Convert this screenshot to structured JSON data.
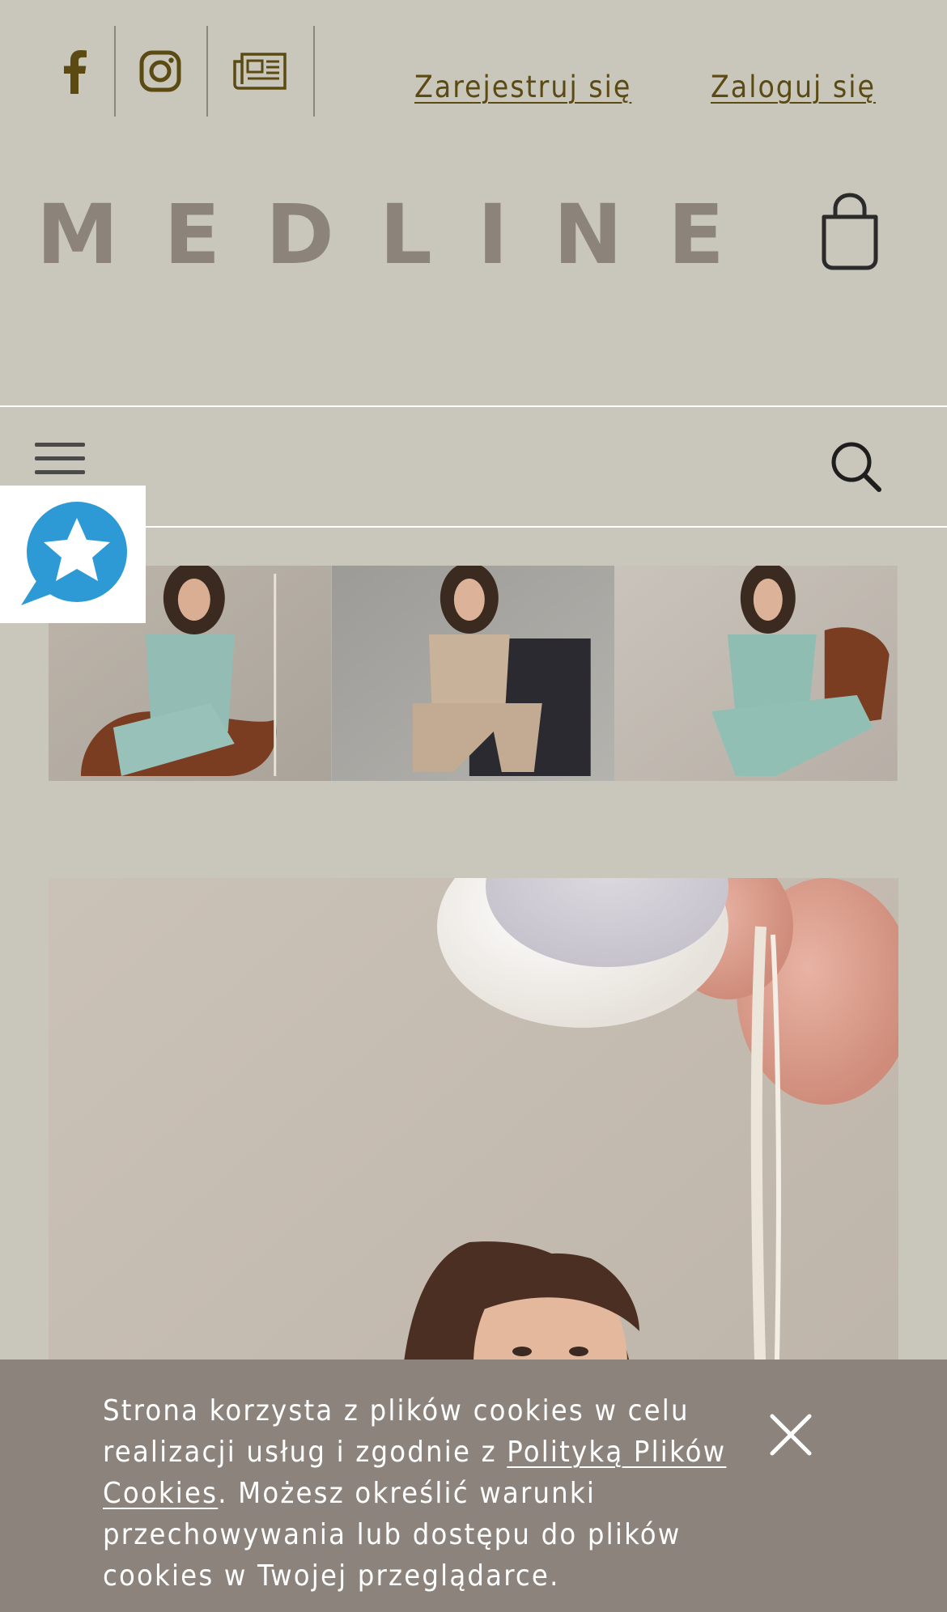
{
  "header": {
    "social": [
      {
        "icon": "facebook-icon"
      },
      {
        "icon": "instagram-icon"
      },
      {
        "icon": "newspaper-icon"
      }
    ],
    "register_label": "Zarejestruj się",
    "login_label": "Zaloguj się",
    "logo_text": "MEDLINE",
    "cart_icon": "shopping-bag-icon"
  },
  "nav": {
    "menu_icon": "hamburger-menu-icon",
    "search_icon": "search-icon"
  },
  "review_badge": {
    "icon": "star-chat-icon",
    "color": "#2d9ad6"
  },
  "colors": {
    "background": "#c9c6bb",
    "link": "#5b4a12",
    "logo": "#8c837b",
    "cookie_bg": "#8c847c"
  },
  "cookie_banner": {
    "text_before": "Strona korzysta z plików cookies w celu realizacji usług i zgodnie z ",
    "link_text": "Polityką Plików Cookies",
    "text_after": ". Możesz określić warunki przechowywania lub dostępu do plików cookies w Twojej przeglądarce.",
    "close_icon": "close-icon"
  }
}
